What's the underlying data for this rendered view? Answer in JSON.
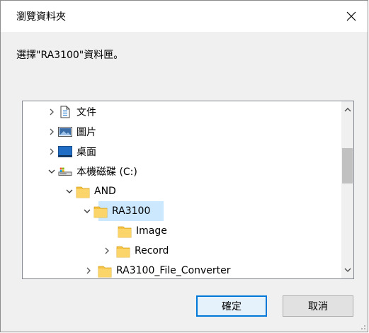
{
  "window": {
    "title": "瀏覽資料夾"
  },
  "instruction": "選擇\"RA3100\"資料匣。",
  "tree": {
    "items": [
      {
        "label": "文件",
        "icon": "document-icon",
        "expander": "collapsed"
      },
      {
        "label": "圖片",
        "icon": "pictures-icon",
        "expander": "collapsed"
      },
      {
        "label": "桌面",
        "icon": "desktop-icon",
        "expander": "collapsed"
      },
      {
        "label": "本機磁碟 (C:)",
        "icon": "drive-icon",
        "expander": "expanded"
      },
      {
        "label": "AND",
        "icon": "folder-icon",
        "expander": "expanded"
      },
      {
        "label": "RA3100",
        "icon": "folder-icon",
        "expander": "expanded",
        "selected": true
      },
      {
        "label": "Image",
        "icon": "folder-icon",
        "expander": "none"
      },
      {
        "label": "Record",
        "icon": "folder-icon",
        "expander": "collapsed"
      },
      {
        "label": "RA3100_File_Converter",
        "icon": "folder-icon",
        "expander": "collapsed"
      }
    ]
  },
  "buttons": {
    "ok": "確定",
    "cancel": "取消"
  },
  "colors": {
    "selection": "#cce8ff",
    "folder": "#f6c243",
    "accent": "#0078d7"
  }
}
